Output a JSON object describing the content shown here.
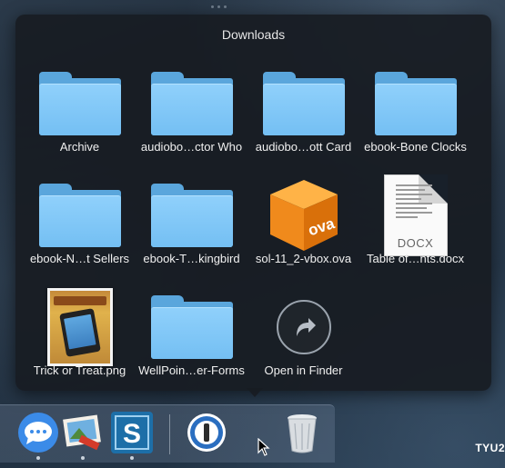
{
  "stack": {
    "title": "Downloads",
    "items": [
      {
        "label": "Archive",
        "icon": "folder-icon",
        "kind": "folder"
      },
      {
        "label": "audiobo…ctor Who",
        "icon": "folder-icon",
        "kind": "folder"
      },
      {
        "label": "audiobo…ott Card",
        "icon": "folder-icon",
        "kind": "folder"
      },
      {
        "label": "ebook-Bone Clocks",
        "icon": "folder-icon",
        "kind": "folder"
      },
      {
        "label": "ebook-N…t Sellers",
        "icon": "folder-icon",
        "kind": "folder"
      },
      {
        "label": "ebook-T…kingbird",
        "icon": "folder-icon",
        "kind": "folder"
      },
      {
        "label": "sol-11_2-vbox.ova",
        "icon": "ova-file-icon",
        "kind": "ova",
        "icon_text": "ova"
      },
      {
        "label": "Table of…nts.docx",
        "icon": "docx-file-icon",
        "kind": "docx",
        "icon_text": "DOCX"
      },
      {
        "label": "Trick or Treat.png",
        "icon": "png-thumbnail-icon",
        "kind": "png"
      },
      {
        "label": "WellPoin…er-Forms",
        "icon": "folder-icon",
        "kind": "folder"
      },
      {
        "label": "Open in Finder",
        "icon": "open-in-finder-arrow-icon",
        "kind": "action"
      }
    ]
  },
  "dock": {
    "items": [
      {
        "name": "messages-icon",
        "running": true
      },
      {
        "name": "photo-app-icon",
        "running": true
      },
      {
        "name": "snagit-icon",
        "running": true
      },
      {
        "name": "1password-icon",
        "running": false
      },
      {
        "name": "trash-icon",
        "running": false
      }
    ]
  },
  "corner_text": "TYU2",
  "colors": {
    "folder": "#74bff3",
    "panel": "#181c22",
    "ova_orange": "#f08a1c"
  }
}
